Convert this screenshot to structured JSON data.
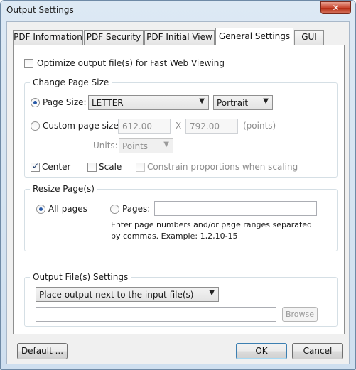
{
  "window": {
    "title": "Output Settings",
    "close_glyph": "✕"
  },
  "tabs": [
    {
      "label": "PDF Information"
    },
    {
      "label": "PDF Security"
    },
    {
      "label": "PDF Initial View"
    },
    {
      "label": "General Settings"
    },
    {
      "label": "GUI"
    }
  ],
  "general": {
    "optimize_label": "Optimize output file(s) for Fast Web Viewing",
    "optimize_checked": false,
    "change_page_size": {
      "title": "Change Page Size",
      "page_size_label": "Page Size:",
      "page_size_value": "LETTER",
      "orientation_value": "Portrait",
      "custom_label": "Custom page size:",
      "width_value": "612.00",
      "x_label": "X",
      "height_value": "792.00",
      "points_label": "(points)",
      "units_label": "Units:",
      "units_value": "Points",
      "center_label": "Center",
      "scale_label": "Scale",
      "constrain_label": "Constrain proportions when scaling"
    },
    "resize_pages": {
      "title": "Resize Page(s)",
      "all_pages_label": "All pages",
      "pages_label": "Pages:",
      "pages_value": "",
      "hint_line1": "Enter page numbers and/or page ranges separated",
      "hint_line2": "by commas. Example: 1,2,10-15"
    },
    "output_files": {
      "title": "Output File(s) Settings",
      "location_value": "Place output next to the input file(s)",
      "path_value": "",
      "browse_label": "Browse"
    }
  },
  "footer": {
    "default_label": "Default ...",
    "ok_label": "OK",
    "cancel_label": "Cancel"
  }
}
